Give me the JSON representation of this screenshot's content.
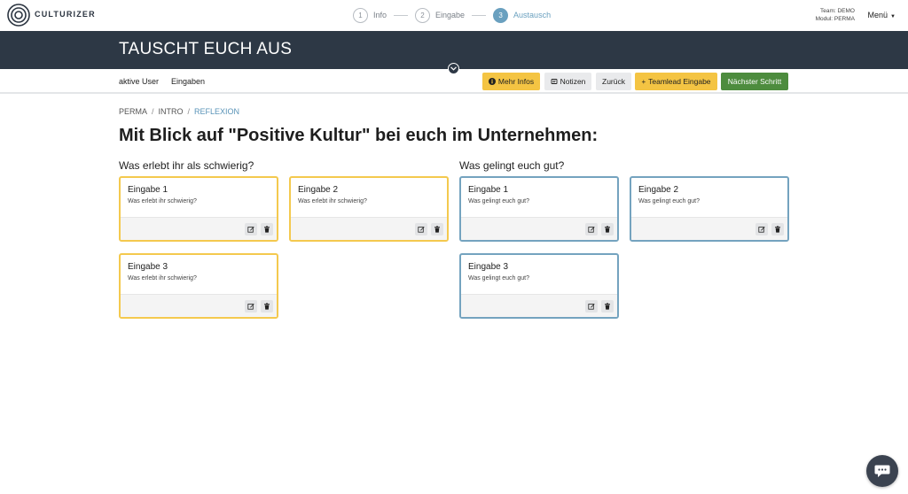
{
  "app": {
    "logo_text": "CULTURIZER"
  },
  "steps": [
    {
      "num": "1",
      "label": "Info"
    },
    {
      "num": "2",
      "label": "Eingabe"
    },
    {
      "num": "3",
      "label": "Austausch",
      "active": true
    }
  ],
  "team": {
    "team_line": "Team: DEMO",
    "module_line": "Modul: PERMA"
  },
  "menu": {
    "label": "Menü"
  },
  "header": {
    "title": "TAUSCHT EUCH AUS"
  },
  "subnav": {
    "links": [
      "aktive User",
      "Eingaben"
    ],
    "buttons": {
      "info": "Mehr Infos",
      "notes": "Notizen",
      "back": "Zurück",
      "teamlead": "Teamlead Eingabe",
      "next": "Nächster Schritt"
    }
  },
  "breadcrumb": [
    "PERMA",
    "INTRO",
    "REFLEXION"
  ],
  "main": {
    "title": "Mit Blick auf \"Positive Kultur\" bei euch im Unternehmen:",
    "columns": [
      {
        "title": "Was erlebt ihr als schwierig?",
        "cards": [
          {
            "title": "Eingabe 1",
            "text": "Was erlebt ihr schwierig?"
          },
          {
            "title": "Eingabe 2",
            "text": "Was erlebt ihr schwierig?"
          },
          {
            "title": "Eingabe 3",
            "text": "Was erlebt ihr schwierig?"
          }
        ]
      },
      {
        "title": "Was gelingt euch gut?",
        "cards": [
          {
            "title": "Eingabe 1",
            "text": "Was gelingt euch gut?"
          },
          {
            "title": "Eingabe 2",
            "text": "Was gelingt euch gut?"
          },
          {
            "title": "Eingabe 3",
            "text": "Was gelingt euch gut?"
          }
        ]
      }
    ]
  },
  "colors": {
    "header_bg": "#2d3845",
    "accent_blue": "#6aa0bf",
    "card_yellow": "#f4c94e",
    "card_blue": "#74a3bf",
    "btn_green": "#4d8c3e",
    "btn_yellow": "#f4c443"
  },
  "icons": [
    "info-icon",
    "notes-icon",
    "plus-icon",
    "edit-icon",
    "trash-icon",
    "chat-icon",
    "chevron-down-icon"
  ]
}
